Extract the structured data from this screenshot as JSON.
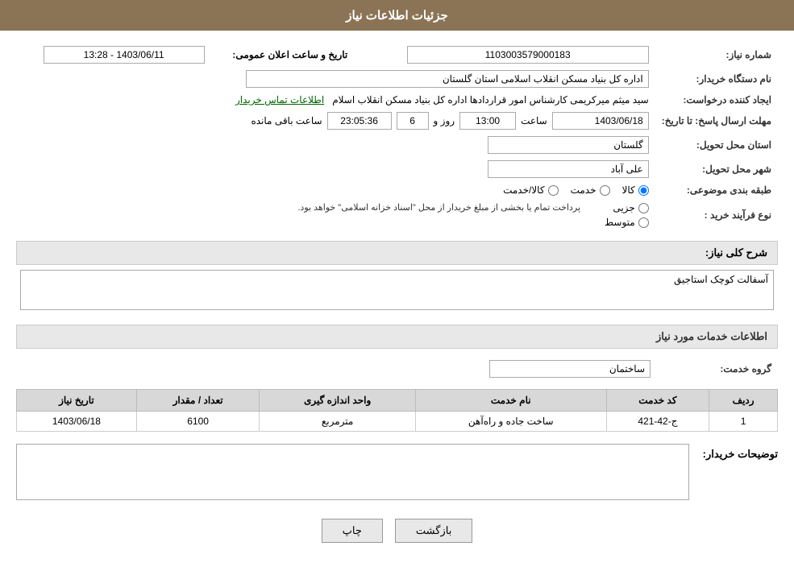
{
  "header": {
    "title": "جزئیات اطلاعات نیاز"
  },
  "fields": {
    "need_number_label": "شماره نیاز:",
    "need_number_value": "1103003579000183",
    "buyer_org_label": "نام دستگاه خریدار:",
    "buyer_org_value": "اداره کل بنیاد مسکن انقلاب اسلامی استان گلستان",
    "requester_label": "ایجاد کننده درخواست:",
    "requester_value": "سید میثم میرکریمی کارشناس امور قراردادها اداره کل بنیاد مسکن انقلاب اسلام",
    "requester_link": "اطلاعات تماس خریدار",
    "deadline_label": "مهلت ارسال پاسخ: تا تاریخ:",
    "deadline_date": "1403/06/18",
    "deadline_time_label": "ساعت",
    "deadline_time": "13:00",
    "deadline_day_label": "روز و",
    "deadline_days": "6",
    "deadline_remaining_label": "ساعت باقی مانده",
    "deadline_remaining": "23:05:36",
    "announce_label": "تاریخ و ساعت اعلان عمومی:",
    "announce_value": "1403/06/11 - 13:28",
    "province_label": "استان محل تحویل:",
    "province_value": "گلستان",
    "city_label": "شهر محل تحویل:",
    "city_value": "علی آباد",
    "category_label": "طبقه بندی موضوعی:",
    "category_options": [
      {
        "id": "kala",
        "label": "کالا"
      },
      {
        "id": "khadamat",
        "label": "خدمت"
      },
      {
        "id": "kala_khadamat",
        "label": "کالا/خدمت"
      }
    ],
    "category_selected": "kala",
    "procurement_label": "نوع فرآیند خرید :",
    "procurement_options": [
      {
        "id": "jozyi",
        "label": "جزیی"
      },
      {
        "id": "motavaset",
        "label": "متوسط"
      },
      {
        "id": "other",
        "label": ""
      }
    ],
    "procurement_note": "پرداخت تمام یا بخشی از مبلغ خریدار از محل \"اسناد خزانه اسلامی\" خواهد بود.",
    "description_label": "شرح کلی نیاز:",
    "description_value": "آسفالت کوچک استاجیق"
  },
  "services_section": {
    "title": "اطلاعات خدمات مورد نیاز",
    "service_group_label": "گروه خدمت:",
    "service_group_value": "ساختمان",
    "table": {
      "headers": [
        "ردیف",
        "کد خدمت",
        "نام خدمت",
        "واحد اندازه گیری",
        "تعداد / مقدار",
        "تاریخ نیاز"
      ],
      "rows": [
        {
          "row_num": "1",
          "code": "ج-42-421",
          "name": "ساخت جاده و راه‌آهن",
          "unit": "مترمربع",
          "quantity": "6100",
          "date": "1403/06/18"
        }
      ]
    }
  },
  "buyer_notes_label": "توضیحات خریدار:",
  "buyer_notes_value": "",
  "buttons": {
    "print": "چاپ",
    "back": "بازگشت"
  }
}
